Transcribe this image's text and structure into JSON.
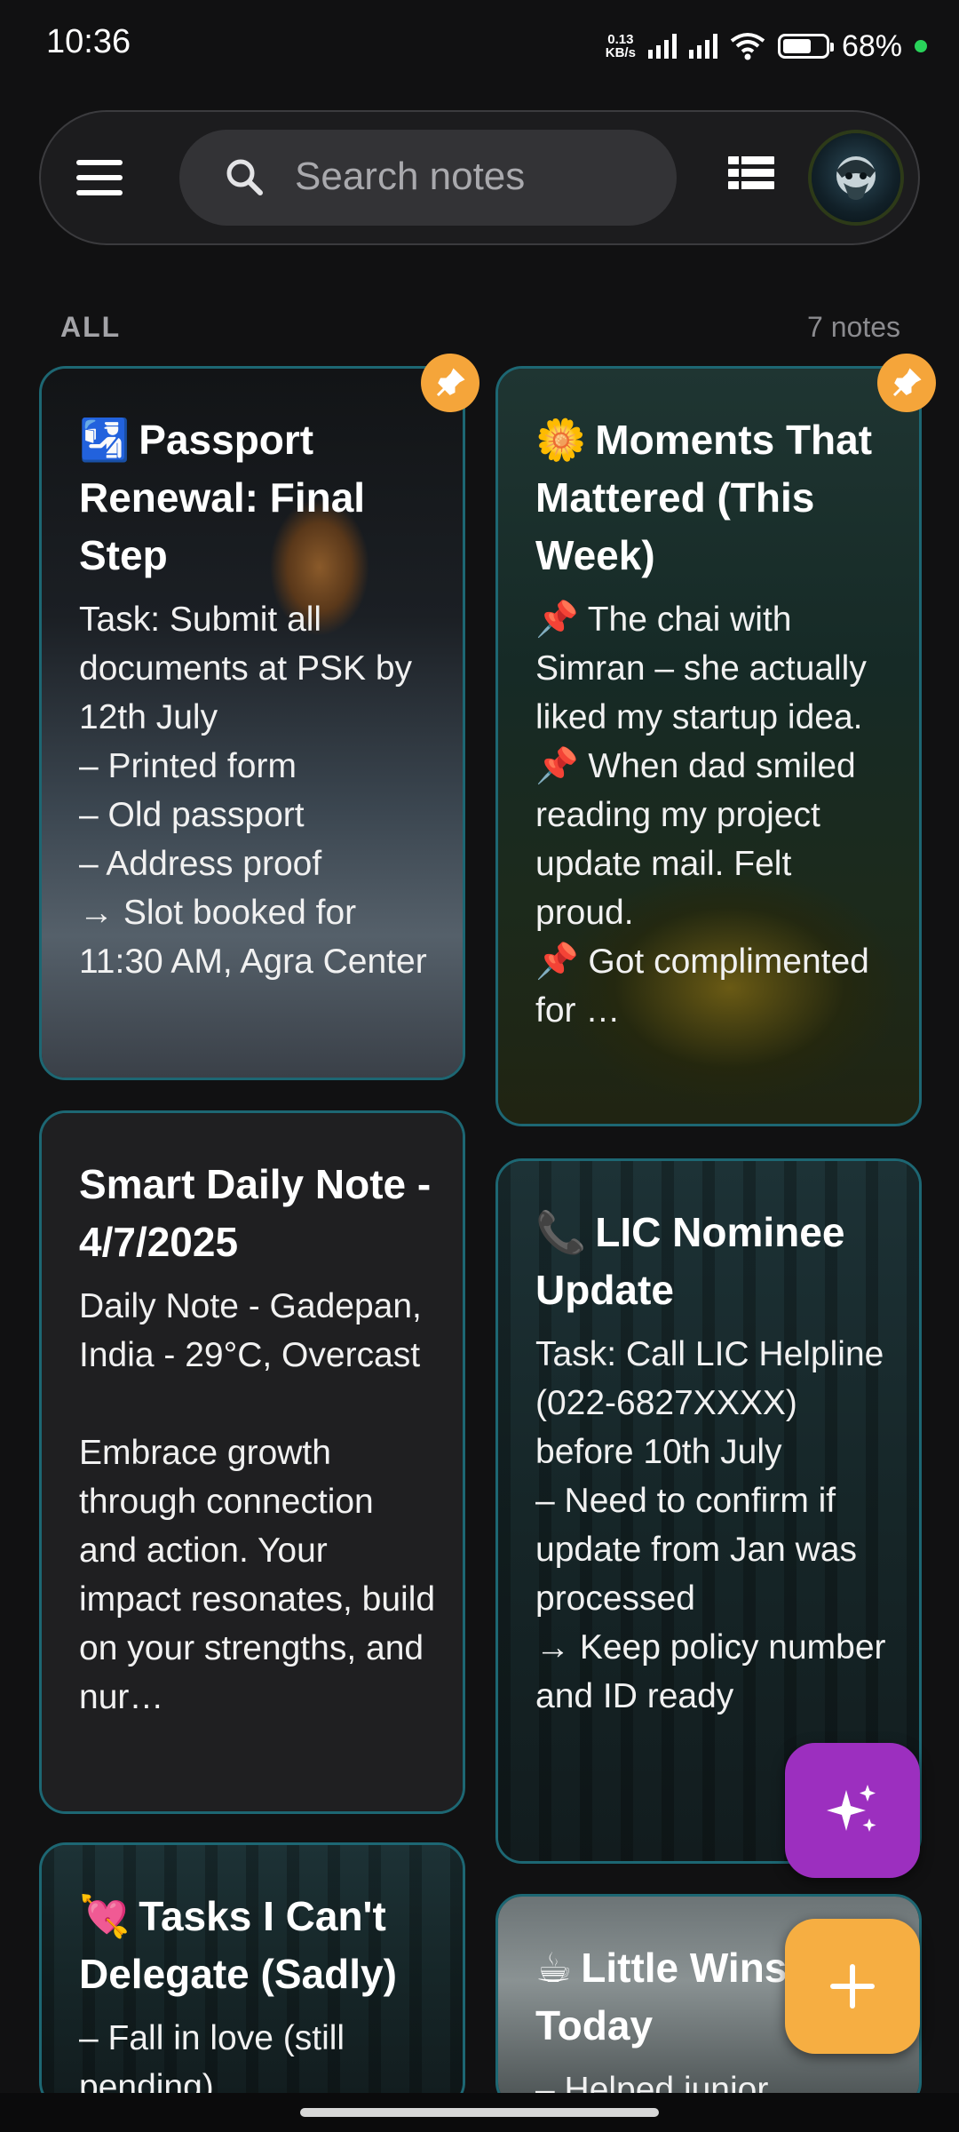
{
  "status_bar": {
    "time": "10:36",
    "net_speed_value": "0.13",
    "net_speed_unit": "KB/s",
    "battery_text": "68%",
    "battery_level": 0.68
  },
  "search": {
    "placeholder": "Search notes"
  },
  "section": {
    "label": "ALL",
    "count": "7 notes"
  },
  "colors": {
    "accent_card_border": "#1d6773",
    "pin_color": "#f5a53a",
    "fab_ai": "#9c2fbf",
    "fab_add": "#f6ae42"
  },
  "notes": [
    {
      "emoji": "🛂",
      "title": "Passport Renewal: Final Step",
      "body": "Task: Submit all documents at PSK by 12th July\n– Printed form\n– Old passport\n– Address proof\n→ Slot booked for 11:30 AM, Agra Center",
      "pinned": true
    },
    {
      "emoji": "🌼",
      "title": "Moments That Mattered (This Week)",
      "body": "📌 The chai with Simran – she actually liked my startup idea.\n📌 When dad smiled reading my project update mail. Felt proud.\n📌 Got complimented for …",
      "pinned": true
    },
    {
      "emoji": "",
      "title": "Smart Daily Note - 4/7/2025",
      "body": "Daily Note - Gadepan, India - 29°C, Overcast\n\nEmbrace growth through connection and action. Your impact resonates, build on your strengths, and nur…",
      "pinned": false
    },
    {
      "emoji": "📞",
      "title": "LIC Nominee Update",
      "body": "Task: Call LIC Helpline (022-6827XXXX) before 10th July\n– Need to confirm if update from Jan was processed\n→ Keep policy number and ID ready",
      "pinned": false
    },
    {
      "emoji": "💘",
      "title": "Tasks I Can't Delegate (Sadly)",
      "body": "– Fall in love (still pending)",
      "pinned": false
    },
    {
      "emoji": "☕",
      "title": "Little Wins Today",
      "body": "– Helped junior",
      "pinned": false
    }
  ]
}
